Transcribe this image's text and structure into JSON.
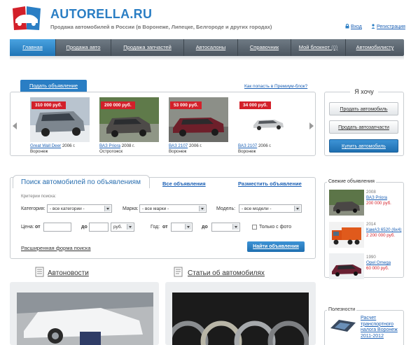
{
  "header": {
    "site_title": "AUTORELLA.RU",
    "subtitle": "Продажа автомобилей в России (в Воронеже, Липецке, Белгороде и других городах)",
    "login": "Вход",
    "register": "Регистрация"
  },
  "nav": [
    {
      "label": "Главная",
      "active": true
    },
    {
      "label": "Продажа авто"
    },
    {
      "label": "Продажа запчастей"
    },
    {
      "label": "Автосалоны"
    },
    {
      "label": "Справочник"
    },
    {
      "label": "Мой блокнот",
      "count": "(0)"
    },
    {
      "label": "Автомобилисту"
    }
  ],
  "premium": {
    "tab": "Подать объявление",
    "how_link": "Как попасть в Премиум-блок?",
    "cards": [
      {
        "price": "310 000 руб.",
        "title": "Great Wall Deer",
        "year": "2006 г.",
        "city": "Воронеж"
      },
      {
        "price": "200 000 руб.",
        "title": "ВАЗ Priora",
        "year": "2008 г.",
        "city": "Острогожск"
      },
      {
        "price": "53 000 руб.",
        "title": "ВАЗ 2107",
        "year": "2006 г.",
        "city": "Воронеж"
      },
      {
        "price": "34 000 руб.",
        "title": "ВАЗ 2107",
        "year": "2006 г.",
        "city": "Воронеж"
      }
    ]
  },
  "want": {
    "title": "Я хочу",
    "buttons": [
      "Продать автомобиль",
      "Продать автозапчасти",
      "Купить автомобиль"
    ]
  },
  "search": {
    "tab_active": "Поиск автомобилей по объявлениям",
    "tab_all": "Все объявления",
    "tab_post": "Разместить объявление",
    "criteria": "Критерии поиска:",
    "category_label": "Категория:",
    "category_value": "- все категории -",
    "brand_label": "Марка:",
    "brand_value": "- все марки -",
    "model_label": "Модель:",
    "model_value": "- все модели -",
    "price_label": "Цена:",
    "from": "от",
    "to": "до",
    "currency": "руб.",
    "year_label": "Год:",
    "with_photo": "Только с фото",
    "advanced": "Расширенная форма поиска",
    "find_button": "Найти объявления"
  },
  "fresh": {
    "title": "Свежие объявления",
    "items": [
      {
        "year": "2008",
        "title": "ВАЗ Priora",
        "price": "200 000 руб."
      },
      {
        "year": "2014",
        "title": "КамАЗ 6520 (6х4)",
        "price": "2 200 000 руб."
      },
      {
        "year": "1990",
        "title": "Opel Omega",
        "price": "60 000 руб."
      }
    ]
  },
  "sections": {
    "news": "Автоновости",
    "articles": "Статьи об автомобилях"
  },
  "useful": {
    "title": "Полезности",
    "item": "Расчет транспортного налога Воронеж 2011-2012"
  }
}
